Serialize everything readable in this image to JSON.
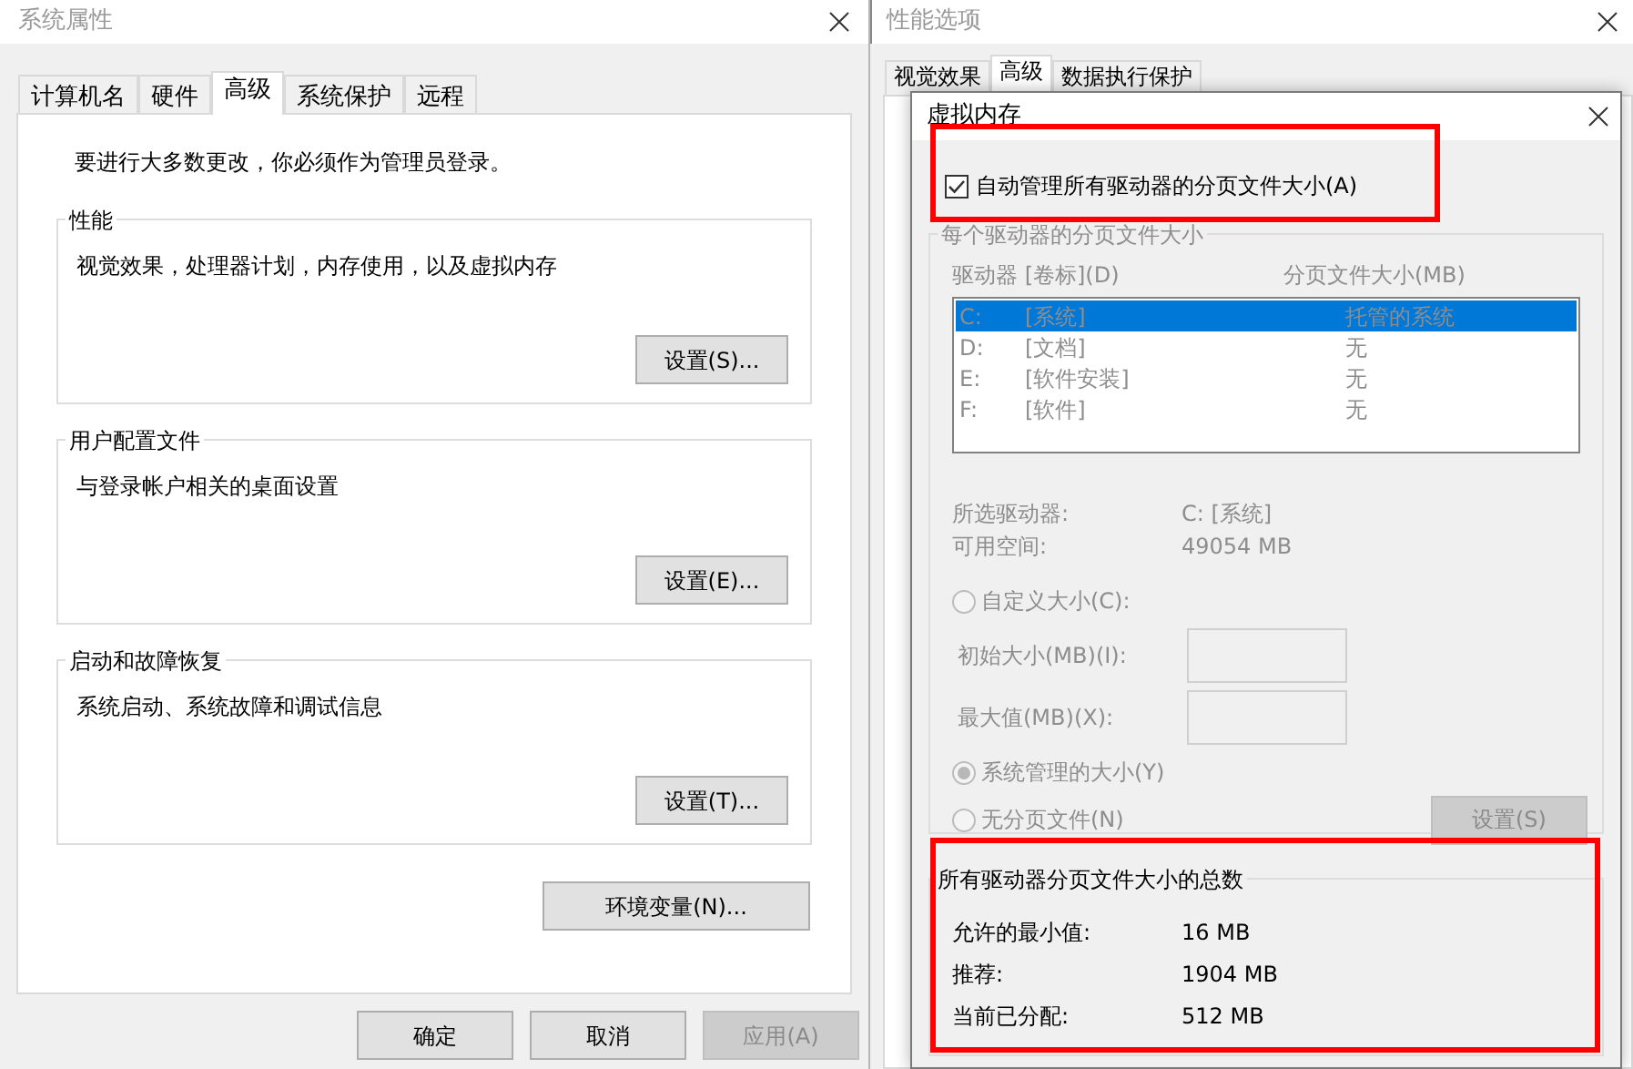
{
  "system_properties": {
    "title": "系统属性",
    "tabs": [
      {
        "label": "计算机名",
        "selected": false
      },
      {
        "label": "硬件",
        "selected": false
      },
      {
        "label": "高级",
        "selected": true
      },
      {
        "label": "系统保护",
        "selected": false
      },
      {
        "label": "远程",
        "selected": false
      }
    ],
    "notice": "要进行大多数更改，你必须作为管理员登录。",
    "groups": [
      {
        "title": "性能",
        "description": "视觉效果，处理器计划，内存使用，以及虚拟内存",
        "button": "设置(S)..."
      },
      {
        "title": "用户配置文件",
        "description": "与登录帐户相关的桌面设置",
        "button": "设置(E)..."
      },
      {
        "title": "启动和故障恢复",
        "description": "系统启动、系统故障和调试信息",
        "button": "设置(T)..."
      }
    ],
    "env_button": "环境变量(N)...",
    "buttons": [
      {
        "label": "确定",
        "disabled": false
      },
      {
        "label": "取消",
        "disabled": false
      },
      {
        "label": "应用(A)",
        "disabled": true
      }
    ]
  },
  "performance_options": {
    "title": "性能选项",
    "tabs": [
      {
        "label": "视觉效果",
        "selected": false
      },
      {
        "label": "高级",
        "selected": true
      },
      {
        "label": "数据执行保护",
        "selected": false
      }
    ]
  },
  "virtual_memory": {
    "title": "虚拟内存",
    "auto_manage": {
      "label": "自动管理所有驱动器的分页文件大小(A)",
      "checked": true,
      "highlighted": true
    },
    "per_drive": {
      "title": "每个驱动器的分页文件大小",
      "disabled": true,
      "columns": [
        "驱动器 [卷标](D)",
        "分页文件大小(MB)"
      ],
      "drives": [
        {
          "drive": "C:",
          "label": "[系统]",
          "size": "托管的系统",
          "selected": true
        },
        {
          "drive": "D:",
          "label": "[文档]",
          "size": "无",
          "selected": false
        },
        {
          "drive": "E:",
          "label": "[软件安装]",
          "size": "无",
          "selected": false
        },
        {
          "drive": "F:",
          "label": "[软件]",
          "size": "无",
          "selected": false
        }
      ],
      "selected_drive_label": "所选驱动器:",
      "selected_drive": "C:  [系统]",
      "free_space_label": "可用空间:",
      "free_space": "49054 MB",
      "options": [
        {
          "kind": "radio",
          "label": "自定义大小(C):",
          "selected": false
        },
        {
          "kind": "field",
          "label": "初始大小(MB)(I):"
        },
        {
          "kind": "field",
          "label": "最大值(MB)(X):"
        },
        {
          "kind": "radio",
          "label": "系统管理的大小(Y)",
          "selected": true
        },
        {
          "kind": "radio",
          "label": "无分页文件(N)",
          "selected": false
        }
      ],
      "set_button": "设置(S)"
    },
    "totals": {
      "title": "所有驱动器分页文件大小的总数",
      "highlighted": true,
      "rows": [
        {
          "label": "允许的最小值:",
          "value": "16 MB"
        },
        {
          "label": "推荐:",
          "value": "1904 MB"
        },
        {
          "label": "当前已分配:",
          "value": "512 MB"
        }
      ]
    }
  }
}
